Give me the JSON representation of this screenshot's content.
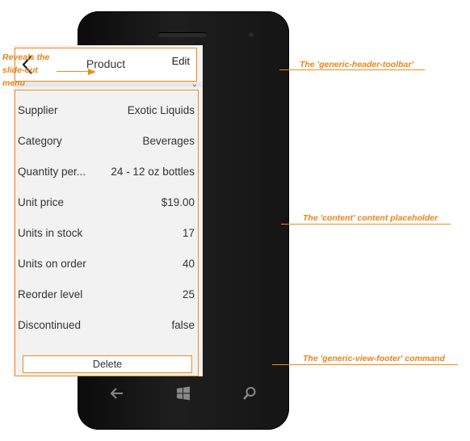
{
  "header": {
    "title": "Product",
    "edit_label": "Edit"
  },
  "rows": [
    {
      "label": "Supplier",
      "value": "Exotic Liquids"
    },
    {
      "label": "Category",
      "value": "Beverages"
    },
    {
      "label": "Quantity per...",
      "value": "24 - 12 oz bottles"
    },
    {
      "label": "Unit price",
      "value": "$19.00"
    },
    {
      "label": "Units in stock",
      "value": "17"
    },
    {
      "label": "Units on order",
      "value": "40"
    },
    {
      "label": "Reorder level",
      "value": "25"
    },
    {
      "label": "Discontinued",
      "value": "false"
    }
  ],
  "footer": {
    "delete_label": "Delete"
  },
  "annotations": {
    "menu": "Reveals the slide-out menu",
    "menu_line1": "Reveals the",
    "menu_line2": "slide-out",
    "menu_line3": "menu",
    "toolbar": "The 'generic-header-toolbar'",
    "content": "The 'content' content placeholder",
    "footer": "The 'generic-view-footer' command"
  },
  "icons": {
    "back": "chevron-left-icon",
    "nav_back": "arrow-left-icon",
    "windows": "windows-logo-icon",
    "search": "search-icon"
  },
  "colors": {
    "accent": "#f08a1c",
    "screen_bg": "#f2f2f2"
  }
}
